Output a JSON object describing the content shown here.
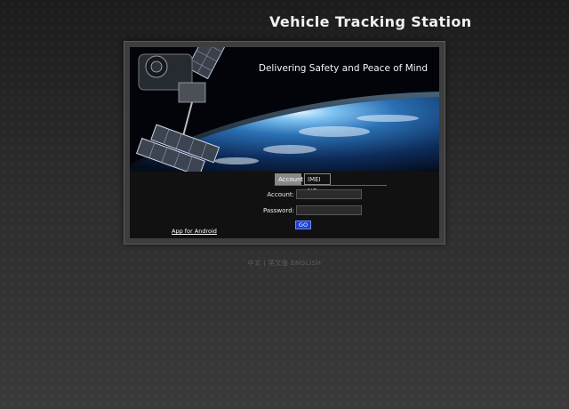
{
  "header": {
    "title": "Vehicle Tracking Station"
  },
  "banner": {
    "tagline": "Delivering Safety and Peace of Mind"
  },
  "login": {
    "tabs": [
      {
        "label": "Account",
        "active": true
      },
      {
        "label": "IMEI NO.",
        "active": false
      }
    ],
    "account_label": "Account:",
    "password_label": "Password:",
    "account_value": "",
    "password_value": "",
    "go_label": "GO",
    "android_link": "App for Android"
  },
  "footer": {
    "text": "中文 | 英文版 ENGLISH"
  },
  "colors": {
    "background": "#2a2a2a",
    "go_button": "#1b3fd8",
    "active_tab": "#888888"
  }
}
